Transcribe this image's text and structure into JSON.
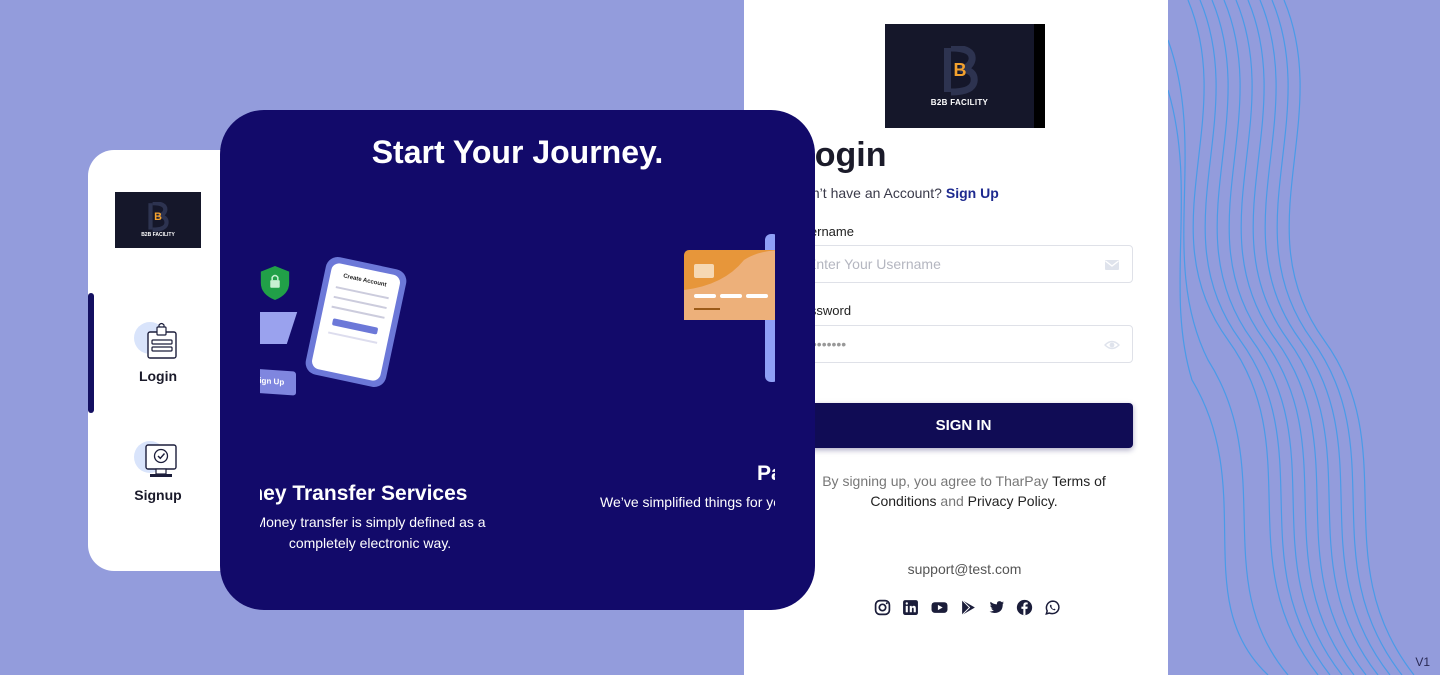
{
  "brand": {
    "logo_text": "B2B FACILITY",
    "logo_letter": "B"
  },
  "login": {
    "title": "Login",
    "no_account_text": "Don’t have an Account?",
    "signup_link": "Sign Up",
    "username_label": "Username",
    "username_placeholder": "Enter Your Username",
    "password_label": "Password",
    "password_value": "••••••••",
    "signin_button": "SIGN IN",
    "terms_prefix": "By signing up, you agree to TharPay",
    "terms_link": "Terms of Conditions",
    "terms_and": "and",
    "privacy_link": "Privacy Policy",
    "terms_suffix": ".",
    "support_email": "support@test.com"
  },
  "social_icons": [
    "instagram-icon",
    "linkedin-icon",
    "youtube-icon",
    "google-play-icon",
    "twitter-icon",
    "facebook-icon",
    "whatsapp-icon"
  ],
  "sidebar": {
    "items": [
      {
        "label": "Login",
        "icon": "login-form-icon",
        "active": true
      },
      {
        "label": "Signup",
        "icon": "signup-monitor-icon",
        "active": false
      }
    ]
  },
  "promo": {
    "title": "Start Your Journey.",
    "slides": [
      {
        "title": "Money Transfer Services",
        "description": "Money transfer is simply defined as a completely electronic way.",
        "mock_heading": "Create Account",
        "mock_button": "Sign Up"
      },
      {
        "title": "Payments",
        "description": "We’ve simplified things for you"
      }
    ]
  },
  "version": "V1",
  "colors": {
    "background": "#939cdc",
    "promo_bg": "#120a6a",
    "button": "#100c55",
    "link": "#1e2a8f",
    "accent_orange": "#e99a3a"
  }
}
